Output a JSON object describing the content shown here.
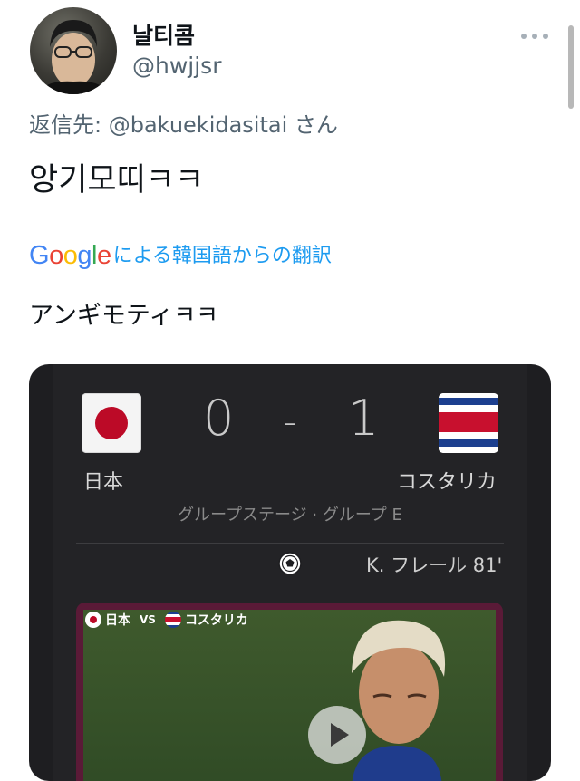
{
  "tweet": {
    "display_name": "날티콤",
    "handle": "@hwjjsr",
    "reply_prefix": "返信先: ",
    "reply_mention": "@bakuekidasitai",
    "reply_suffix": " さん",
    "text": "앙기모띠ㅋㅋ",
    "translate_brand": "Google",
    "translate_label": "による韓国語からの翻訳",
    "translated_text": "アンギモティㅋㅋ"
  },
  "match_card": {
    "home_team": "日本",
    "away_team": "コスタリカ",
    "home_score": "0",
    "separator": "-",
    "away_score": "1",
    "stage": "グループステージ · グループ E",
    "goal_event": "K. フレール 81'",
    "video_label_home": "日本",
    "video_label_vs": "VS",
    "video_label_away": "コスタリカ"
  },
  "icons": {
    "more": "more-horizontal-icon",
    "ball": "soccer-ball-icon",
    "play": "play-icon"
  },
  "colors": {
    "link": "#1d9bf0",
    "muted": "#536471",
    "card_bg": "#1e1e21",
    "japan_red": "#bc0a27",
    "cr_blue": "#1c3f8f",
    "cr_red": "#c8102e"
  }
}
